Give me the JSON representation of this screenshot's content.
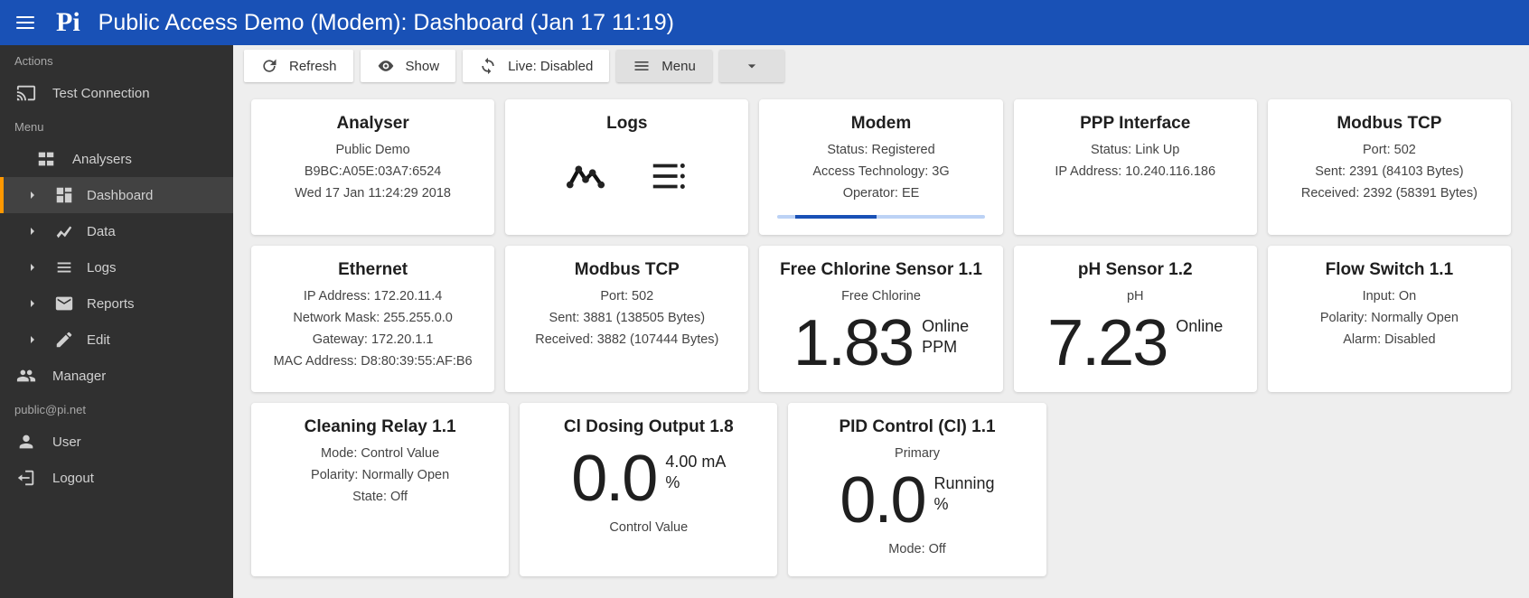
{
  "appbar": {
    "logo": "Pi",
    "title": "Public Access Demo (Modem): Dashboard (Jan 17 11:19)"
  },
  "sidebar": {
    "section_actions": "Actions",
    "test_connection": "Test Connection",
    "section_menu": "Menu",
    "analysers": "Analysers",
    "dashboard": "Dashboard",
    "data": "Data",
    "logs": "Logs",
    "reports": "Reports",
    "edit": "Edit",
    "manager": "Manager",
    "section_user": "public@pi.net",
    "user": "User",
    "logout": "Logout"
  },
  "toolbar": {
    "refresh": "Refresh",
    "show": "Show",
    "live": "Live: Disabled",
    "menu": "Menu"
  },
  "cards": {
    "analyser": {
      "title": "Analyser",
      "l1": "Public Demo",
      "l2": "B9BC:A05E:03A7:6524",
      "l3": "Wed 17 Jan 11:24:29 2018"
    },
    "logs": {
      "title": "Logs"
    },
    "modem": {
      "title": "Modem",
      "l1": "Status: Registered",
      "l2": "Access Technology: 3G",
      "l3": "Operator: EE"
    },
    "ppp": {
      "title": "PPP Interface",
      "l1": "Status: Link Up",
      "l2": "IP Address: 10.240.116.186"
    },
    "modbus1": {
      "title": "Modbus TCP",
      "l1": "Port: 502",
      "l2": "Sent: 2391 (84103 Bytes)",
      "l3": "Received: 2392 (58391 Bytes)"
    },
    "ethernet": {
      "title": "Ethernet",
      "l1": "IP Address: 172.20.11.4",
      "l2": "Network Mask: 255.255.0.0",
      "l3": "Gateway: 172.20.1.1",
      "l4": "MAC Address: D8:80:39:55:AF:B6"
    },
    "modbus2": {
      "title": "Modbus TCP",
      "l1": "Port: 502",
      "l2": "Sent: 3881 (138505 Bytes)",
      "l3": "Received: 3882 (107444 Bytes)"
    },
    "chlorine": {
      "title": "Free Chlorine Sensor 1.1",
      "sub": "Free Chlorine",
      "value": "1.83",
      "status": "Online",
      "unit": "PPM"
    },
    "ph": {
      "title": "pH Sensor 1.2",
      "sub": "pH",
      "value": "7.23",
      "status": "Online"
    },
    "flow": {
      "title": "Flow Switch 1.1",
      "l1": "Input: On",
      "l2": "Polarity: Normally Open",
      "l3": "Alarm: Disabled"
    },
    "relay": {
      "title": "Cleaning Relay 1.1",
      "l1": "Mode: Control Value",
      "l2": "Polarity: Normally Open",
      "l3": "State: Off"
    },
    "dosing": {
      "title": "Cl Dosing Output 1.8",
      "value": "0.0",
      "status": "4.00 mA",
      "unit": "%",
      "cap": "Control Value"
    },
    "pid": {
      "title": "PID Control (Cl) 1.1",
      "sub": "Primary",
      "value": "0.0",
      "status": "Running",
      "unit": "%",
      "cap": "Mode: Off"
    }
  }
}
